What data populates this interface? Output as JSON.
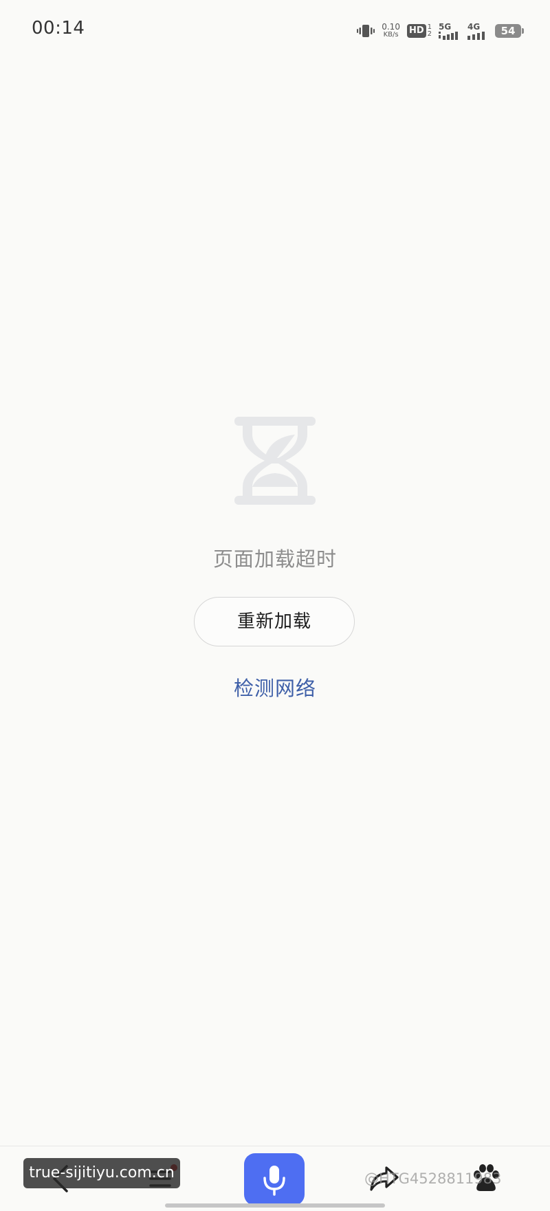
{
  "status_bar": {
    "time": "00:14",
    "net_speed_value": "0.10",
    "net_speed_unit": "KB/s",
    "hd_label": "HD",
    "hd_sub_top": "1",
    "hd_sub_bottom": "2",
    "network_1": "5G",
    "network_2": "4G",
    "battery_level": "54",
    "icons": [
      "vibrate-icon",
      "signal-icon",
      "signal-icon",
      "battery-icon"
    ]
  },
  "error": {
    "icon": "hourglass-icon",
    "message": "页面加载超时",
    "reload_label": "重新加载",
    "check_network_label": "检测网络"
  },
  "toolbar": {
    "icons": [
      "back-icon",
      "menu-icon",
      "microphone-icon",
      "share-icon",
      "baidu-paw-icon"
    ],
    "accent_color": "#4e6ef2"
  },
  "overlays": {
    "site_watermark": "true-sijitiyu.com.cn",
    "user_watermark": "@HTG4528811983"
  },
  "colors": {
    "background": "#fafaf8",
    "link": "#3e5fa8",
    "message": "#8d8d8d"
  }
}
